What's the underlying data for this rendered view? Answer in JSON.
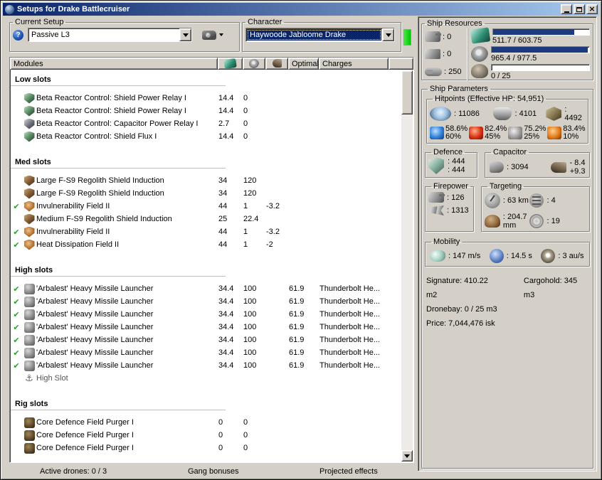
{
  "window": {
    "title": "Setups for Drake Battlecruiser"
  },
  "current_setup": {
    "label": "Current Setup",
    "help": "?",
    "value": "Passive L3"
  },
  "character": {
    "label": "Character",
    "value": "Haywoode Jabloome Drake"
  },
  "modules": {
    "columns": {
      "modules": "Modules",
      "optimal": "Optimal",
      "charges": "Charges"
    },
    "sections": [
      {
        "title": "Low slots",
        "rows": [
          {
            "active": false,
            "icon": "shield-relay",
            "name": "Beta Reactor Control: Shield Power Relay I",
            "cpu": "14.4",
            "pg": "0",
            "ammo": "",
            "optimal": "",
            "charges": ""
          },
          {
            "active": false,
            "icon": "shield-relay",
            "name": "Beta Reactor Control: Shield Power Relay I",
            "cpu": "14.4",
            "pg": "0",
            "ammo": "",
            "optimal": "",
            "charges": ""
          },
          {
            "active": false,
            "icon": "cap-relay",
            "name": "Beta Reactor Control: Capacitor Power Relay I",
            "cpu": "2.7",
            "pg": "0",
            "ammo": "",
            "optimal": "",
            "charges": ""
          },
          {
            "active": false,
            "icon": "shield-relay",
            "name": "Beta Reactor Control: Shield Flux I",
            "cpu": "14.4",
            "pg": "0",
            "ammo": "",
            "optimal": "",
            "charges": ""
          }
        ]
      },
      {
        "title": "Med slots",
        "rows": [
          {
            "active": false,
            "icon": "shield-extender",
            "name": "Large F-S9 Regolith Shield Induction",
            "cpu": "34",
            "pg": "120",
            "ammo": "",
            "optimal": "",
            "charges": ""
          },
          {
            "active": false,
            "icon": "shield-extender",
            "name": "Large F-S9 Regolith Shield Induction",
            "cpu": "34",
            "pg": "120",
            "ammo": "",
            "optimal": "",
            "charges": ""
          },
          {
            "active": true,
            "icon": "hardener",
            "name": "Invulnerability Field II",
            "cpu": "44",
            "pg": "1",
            "ammo": "-3.2",
            "optimal": "",
            "charges": ""
          },
          {
            "active": false,
            "icon": "shield-extender",
            "name": "Medium F-S9 Regolith Shield Induction",
            "cpu": "25",
            "pg": "22.4",
            "ammo": "",
            "optimal": "",
            "charges": ""
          },
          {
            "active": true,
            "icon": "hardener",
            "name": "Invulnerability Field II",
            "cpu": "44",
            "pg": "1",
            "ammo": "-3.2",
            "optimal": "",
            "charges": ""
          },
          {
            "active": true,
            "icon": "hardener",
            "name": "Heat Dissipation Field II",
            "cpu": "44",
            "pg": "1",
            "ammo": "-2",
            "optimal": "",
            "charges": ""
          }
        ]
      },
      {
        "title": "High slots",
        "rows": [
          {
            "active": true,
            "icon": "missile-launcher",
            "name": "'Arbalest' Heavy Missile Launcher",
            "cpu": "34.4",
            "pg": "100",
            "ammo": "",
            "optimal": "61.9",
            "charges": "Thunderbolt He..."
          },
          {
            "active": true,
            "icon": "missile-launcher",
            "name": "'Arbalest' Heavy Missile Launcher",
            "cpu": "34.4",
            "pg": "100",
            "ammo": "",
            "optimal": "61.9",
            "charges": "Thunderbolt He..."
          },
          {
            "active": true,
            "icon": "missile-launcher",
            "name": "'Arbalest' Heavy Missile Launcher",
            "cpu": "34.4",
            "pg": "100",
            "ammo": "",
            "optimal": "61.9",
            "charges": "Thunderbolt He..."
          },
          {
            "active": true,
            "icon": "missile-launcher",
            "name": "'Arbalest' Heavy Missile Launcher",
            "cpu": "34.4",
            "pg": "100",
            "ammo": "",
            "optimal": "61.9",
            "charges": "Thunderbolt He..."
          },
          {
            "active": true,
            "icon": "missile-launcher",
            "name": "'Arbalest' Heavy Missile Launcher",
            "cpu": "34.4",
            "pg": "100",
            "ammo": "",
            "optimal": "61.9",
            "charges": "Thunderbolt He..."
          },
          {
            "active": true,
            "icon": "missile-launcher",
            "name": "'Arbalest' Heavy Missile Launcher",
            "cpu": "34.4",
            "pg": "100",
            "ammo": "",
            "optimal": "61.9",
            "charges": "Thunderbolt He..."
          },
          {
            "active": true,
            "icon": "missile-launcher",
            "name": "'Arbalest' Heavy Missile Launcher",
            "cpu": "34.4",
            "pg": "100",
            "ammo": "",
            "optimal": "61.9",
            "charges": "Thunderbolt He..."
          },
          {
            "active": false,
            "empty": true,
            "icon": "empty-high",
            "name": "High Slot",
            "cpu": "",
            "pg": "",
            "ammo": "",
            "optimal": "",
            "charges": ""
          }
        ]
      },
      {
        "title": "Rig slots",
        "rows": [
          {
            "active": false,
            "icon": "rig",
            "name": "Core Defence Field Purger I",
            "cpu": "0",
            "pg": "0",
            "ammo": "",
            "optimal": "",
            "charges": ""
          },
          {
            "active": false,
            "icon": "rig",
            "name": "Core Defence Field Purger I",
            "cpu": "0",
            "pg": "0",
            "ammo": "",
            "optimal": "",
            "charges": ""
          },
          {
            "active": false,
            "icon": "rig",
            "name": "Core Defence Field Purger I",
            "cpu": "0",
            "pg": "0",
            "ammo": "",
            "optimal": "",
            "charges": ""
          }
        ]
      }
    ]
  },
  "statusbar": {
    "active_drones": "Active drones: 0 / 3",
    "gang_bonuses": "Gang bonuses",
    "projected_effects": "Projected effects"
  },
  "ship_resources": {
    "label": "Ship Resources",
    "turrets": ": 0",
    "launchers": ": 0",
    "calibration": ": 250",
    "cpu": {
      "text": "511.7 / 603.75",
      "pct": 84.7
    },
    "powergrid": {
      "text": "965.4 / 977.5",
      "pct": 98.8
    },
    "drones": {
      "text": "0 / 25",
      "pct": 0
    }
  },
  "ship_parameters": {
    "label": "Ship Parameters",
    "hitpoints": {
      "label": "Hitpoints (Effective HP: 54,951)",
      "shield": ": 11086",
      "armor": ": 4101",
      "structure": ": 4492",
      "resists": [
        {
          "type": "em",
          "top": "58.6%",
          "bottom": "60%"
        },
        {
          "type": "thermal",
          "top": "82.4%",
          "bottom": "45%"
        },
        {
          "type": "kinetic",
          "top": "75.2%",
          "bottom": "25%"
        },
        {
          "type": "explosive",
          "top": "83.4%",
          "bottom": "10%"
        }
      ]
    },
    "defence": {
      "label": "Defence",
      "value1": ": 444",
      "value2": ": 444"
    },
    "capacitor": {
      "label": "Capacitor",
      "capacity": ": 3094",
      "drain": "- 8.4",
      "recharge": "+9.3"
    },
    "firepower": {
      "label": "Firepower",
      "turret": ": 126",
      "missile": ": 1313"
    },
    "targeting": {
      "label": "Targeting",
      "range": ": 63 km",
      "max_targets": ": 4",
      "scan_resolution": ": 204.7 mm",
      "sensor_strength": ": 19"
    },
    "mobility": {
      "label": "Mobility",
      "speed": ": 147 m/s",
      "align_time": ": 14.5 s",
      "warp_speed": ": 3 au/s"
    },
    "signature": "Signature: 410.22 m2",
    "cargohold": "Cargohold: 345 m3",
    "dronebay": "Dronebay: 0 / 25 m3",
    "price": "Price: 7,044,476 isk"
  },
  "colors": {
    "titlebar_left": "#0a246a",
    "titlebar_right": "#a6caf0",
    "window_bg": "#d4d0c8",
    "bar_fill": "#1c3a7e",
    "green_indicator": "#00c400",
    "check_green": "#2f9e2f",
    "em_resist": "#2f7fd8",
    "thermal_resist": "#d83010",
    "kinetic_resist": "#9a9a9a",
    "explosive_resist": "#e07818"
  }
}
